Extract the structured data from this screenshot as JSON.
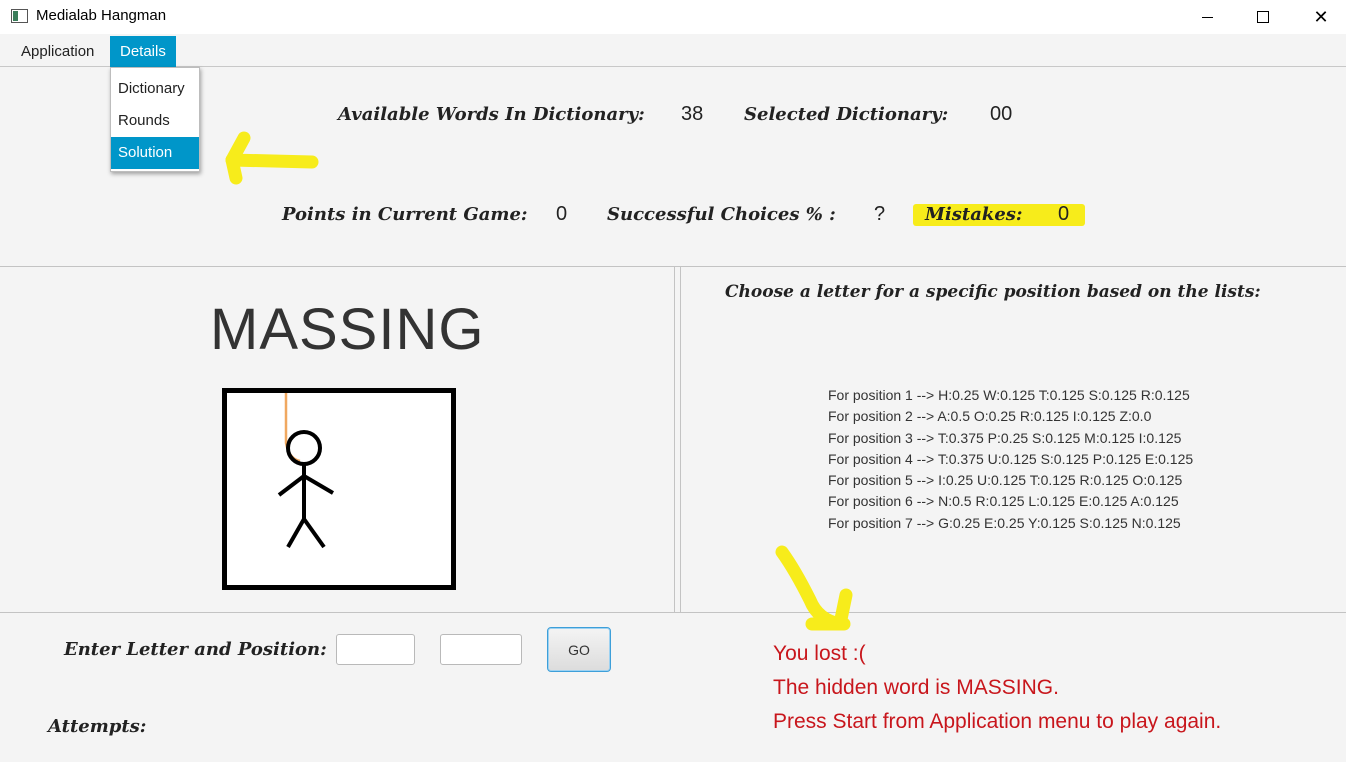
{
  "window": {
    "title": "Medialab Hangman",
    "icons": [
      "app-icon",
      "minimize-icon",
      "maximize-icon",
      "close-icon"
    ]
  },
  "menu": {
    "items": [
      "Application",
      "Details"
    ],
    "dropdown": [
      "Dictionary",
      "Rounds",
      "Solution"
    ],
    "active_menu": "Details",
    "active_dropdown_item": "Solution"
  },
  "stats": {
    "available_label": "Available Words In Dictionary:",
    "available_value": "38",
    "selected_label": "Selected Dictionary:",
    "selected_value": "00",
    "points_label": "Points in Current Game:",
    "points_value": "0",
    "success_label": "Successful Choices % :",
    "success_value": "?",
    "mistakes_label": "Mistakes:",
    "mistakes_value": "0"
  },
  "game": {
    "word": "MASSING",
    "choose_title": "Choose a letter for a specific position based on the lists:",
    "positions": [
      "For position 1 --> H:0.25 W:0.125 T:0.125 S:0.125 R:0.125",
      "For position 2 --> A:0.5 O:0.25 R:0.125 I:0.125 Z:0.0",
      "For position 3 --> T:0.375 P:0.25 S:0.125 M:0.125 I:0.125",
      "For position 4 --> T:0.375 U:0.125 S:0.125 P:0.125 E:0.125",
      "For position 5 --> I:0.25 U:0.125 T:0.125 R:0.125 O:0.125",
      "For position 6 --> N:0.5 R:0.125 L:0.125 E:0.125 A:0.125",
      "For position 7 --> G:0.25 E:0.25 Y:0.125 S:0.125 N:0.125"
    ]
  },
  "input": {
    "label": "Enter Letter and Position:",
    "letter_value": "",
    "position_value": "",
    "go_label": "GO",
    "attempts_label": "Attempts:"
  },
  "result": {
    "line1": "You lost :(",
    "line2": "The hidden word is MASSING.",
    "line3": "Press Start from Application menu to play again."
  },
  "colors": {
    "accent": "#0096c9",
    "result": "#c8161c",
    "annotation": "#f7ec1b",
    "rope": "#f0a860"
  }
}
